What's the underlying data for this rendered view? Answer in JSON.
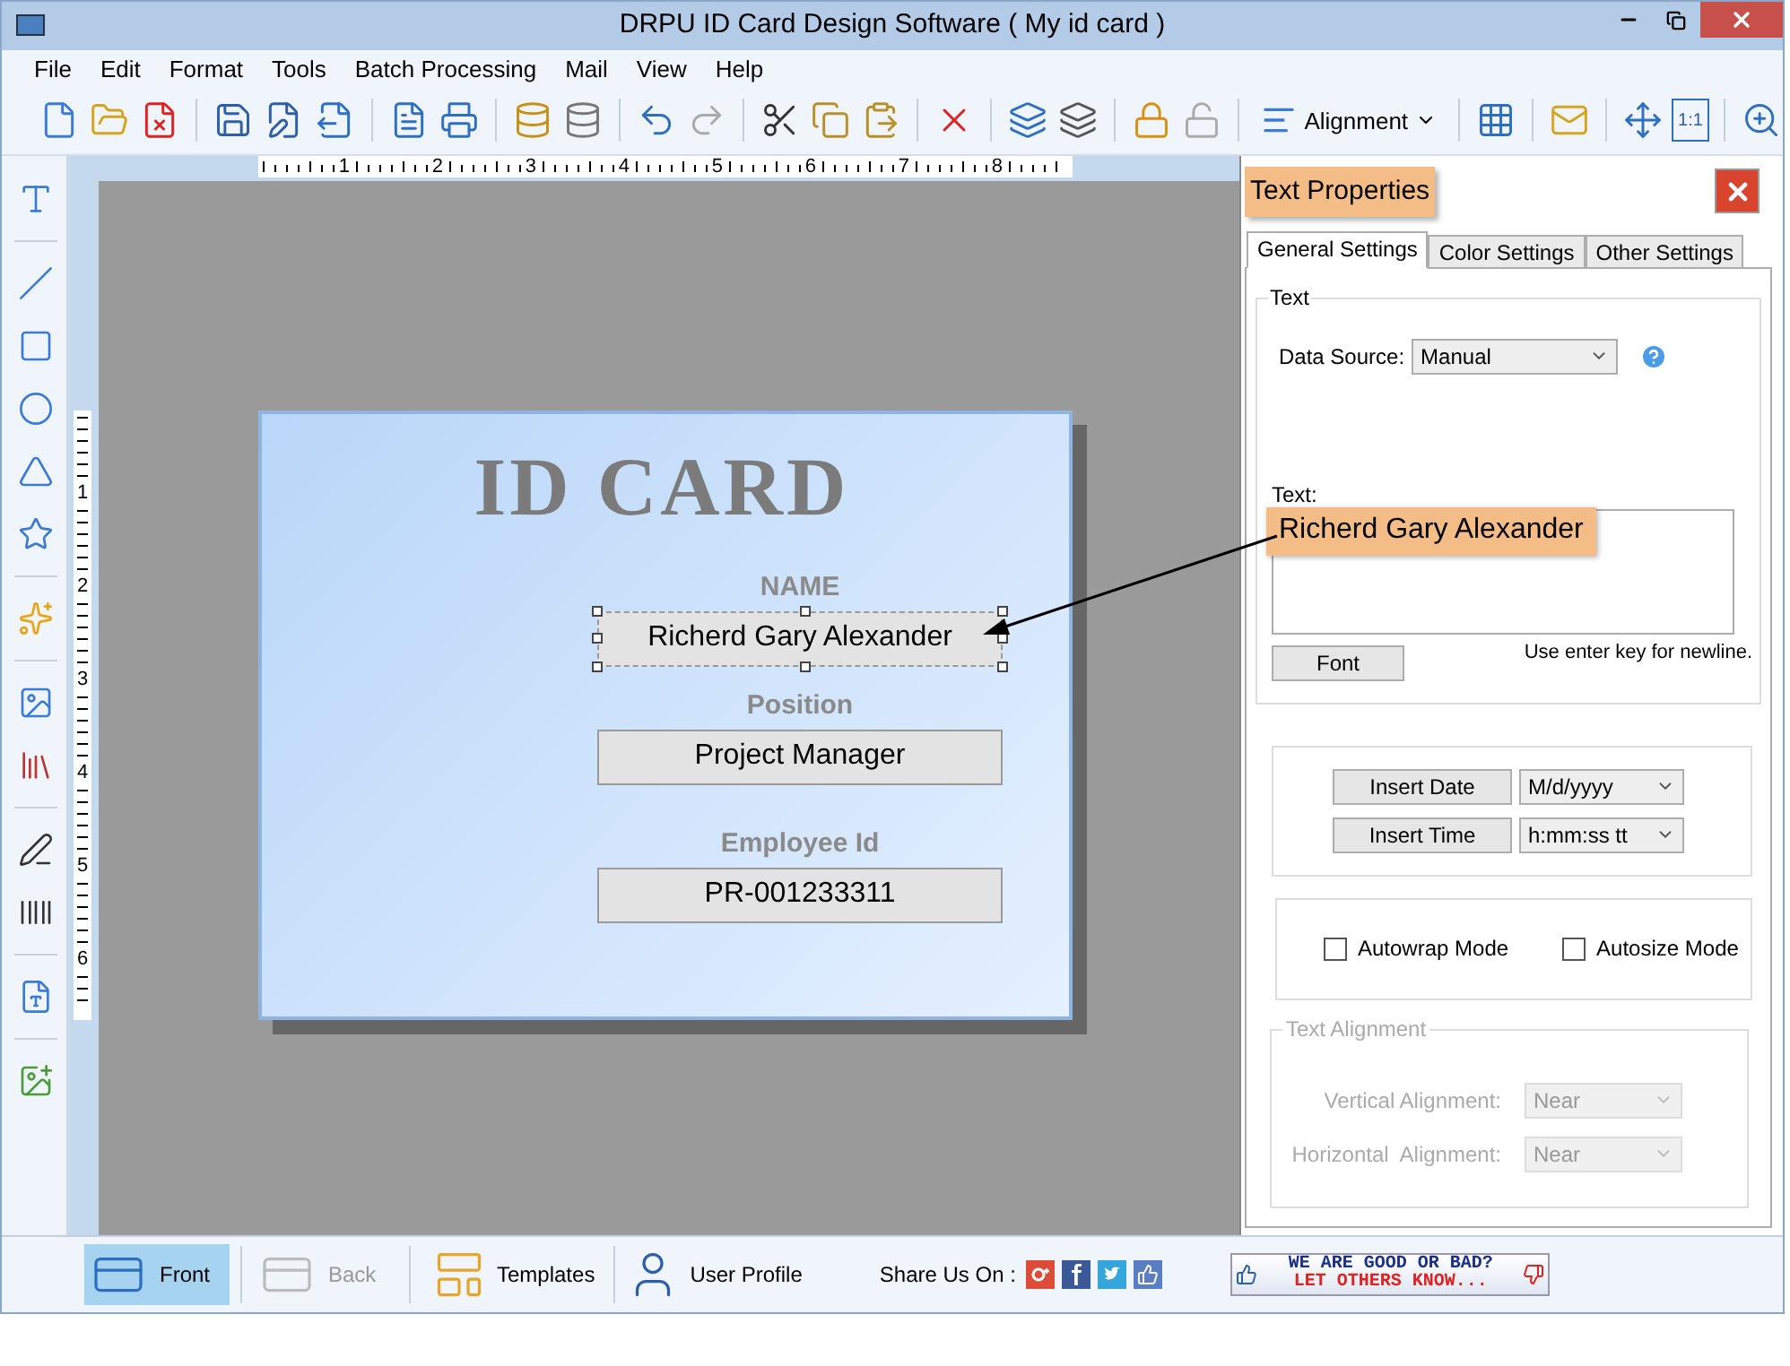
{
  "window": {
    "title": "DRPU ID Card Design Software ( My id card )"
  },
  "menu": [
    "File",
    "Edit",
    "Format",
    "Tools",
    "Batch Processing",
    "Mail",
    "View",
    "Help"
  ],
  "toolbar": {
    "alignment": "Alignment",
    "actual_size": "1:1"
  },
  "ruler": {
    "horizontal": [
      "1",
      "2",
      "3",
      "4",
      "5",
      "6",
      "7",
      "8"
    ],
    "vertical": [
      "1",
      "2",
      "3",
      "4",
      "5",
      "6"
    ]
  },
  "card": {
    "title": "ID CARD",
    "fields": [
      {
        "label": "NAME",
        "value": "Richerd Gary Alexander",
        "selected": true
      },
      {
        "label": "Position",
        "value": "Project Manager",
        "selected": false
      },
      {
        "label": "Employee Id",
        "value": "PR-001233311",
        "selected": false
      }
    ]
  },
  "panel": {
    "title": "Text Properties",
    "tabs": [
      {
        "label": "General Settings",
        "selected": true
      },
      {
        "label": "Color Settings",
        "selected": false
      },
      {
        "label": "Other Settings",
        "selected": false
      }
    ],
    "text_group": {
      "legend": "Text",
      "data_source_label": "Data Source:",
      "data_source": "Manual",
      "text_label": "Text:",
      "text_value": "Richerd Gary Alexander",
      "font_button": "Font",
      "hint": "Use enter key for newline."
    },
    "insert": [
      {
        "button": "Insert Date",
        "format": "M/d/yyyy"
      },
      {
        "button": "Insert Time",
        "format": "h:mm:ss tt"
      }
    ],
    "options": [
      {
        "label": "Autowrap Mode",
        "checked": false
      },
      {
        "label": "Autosize Mode",
        "checked": false
      }
    ],
    "alignment": {
      "legend": "Text Alignment",
      "disabled": true,
      "rows": [
        {
          "label": "Vertical Alignment:",
          "value": "Near"
        },
        {
          "label": "Horizontal  Alignment:",
          "value": "Near"
        }
      ]
    }
  },
  "bottom_bar": {
    "views": [
      {
        "label": "Front",
        "selected": true,
        "disabled": false
      },
      {
        "label": "Back",
        "selected": false,
        "disabled": true
      }
    ],
    "templates": "Templates",
    "user_profile": "User Profile",
    "share_label": "Share Us On :",
    "feedback": {
      "line_1": "WE ARE GOOD OR BAD?",
      "line_2": "LET OTHERS KNOW..."
    }
  }
}
